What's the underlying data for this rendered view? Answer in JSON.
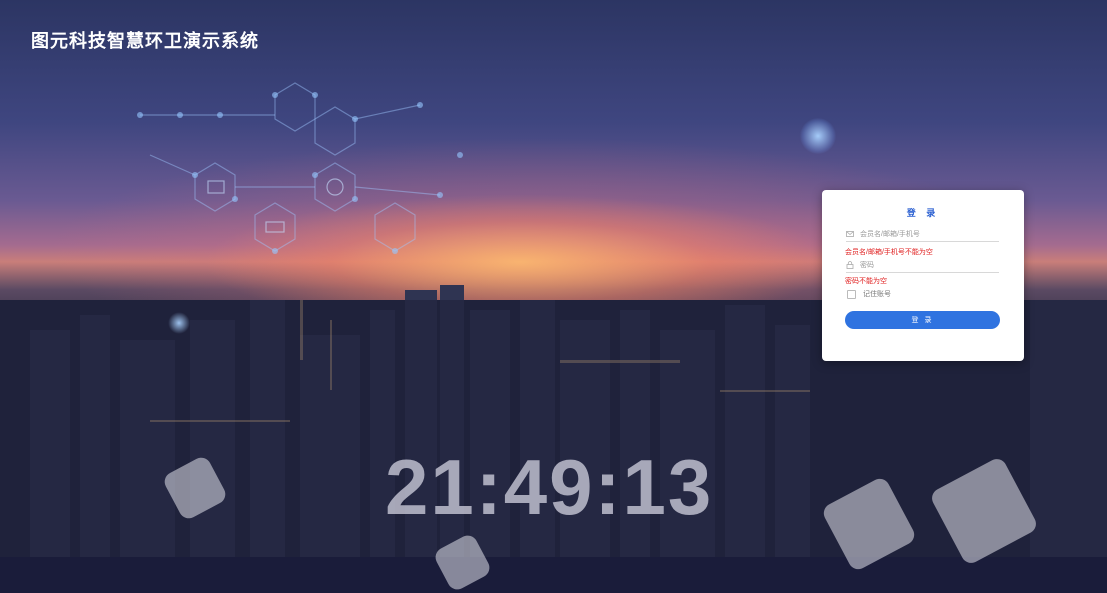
{
  "header": {
    "title": "图元科技智慧环卫演示系统"
  },
  "clock": {
    "time": "21:49:13"
  },
  "login": {
    "title": "登 录",
    "username_placeholder": "会员名/邮箱/手机号",
    "username_error": "会员名/邮箱/手机号不能为空",
    "password_placeholder": "密码",
    "password_error": "密码不能为空",
    "remember_label": "记住账号",
    "submit_label": "登 录"
  },
  "icons": {
    "username": "mail-icon",
    "password": "lock-icon",
    "decor": [
      "monitor-icon",
      "recycle-icon",
      "truck-icon"
    ]
  },
  "colors": {
    "accent": "#2f73e0",
    "error": "#e02020",
    "title": "#ffffff"
  }
}
